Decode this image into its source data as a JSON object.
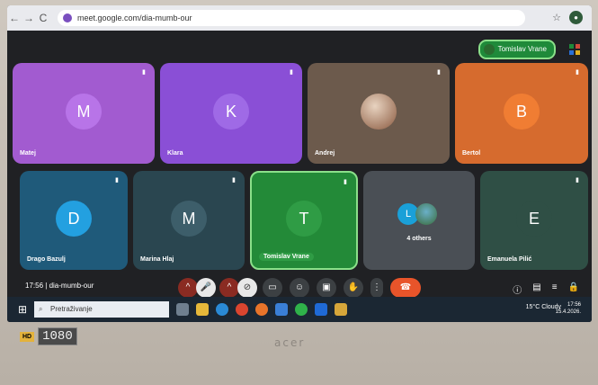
{
  "browser": {
    "url": "meet.google.com/dia-mumb-our"
  },
  "meeting": {
    "user_chip": "Tomislav Vrane",
    "meeting_time": "17:56",
    "meeting_code": "dia-mumb-our"
  },
  "tiles": [
    {
      "name": "Matej",
      "initial": "M",
      "bg": "#a25bd0",
      "circle": "#b874e8"
    },
    {
      "name": "Klara",
      "initial": "K",
      "bg": "#8a4fd6",
      "circle": "#9f6ae6"
    },
    {
      "name": "Andrej",
      "initial": "",
      "bg": "#6c5a4c",
      "circle": "#cfa18a"
    },
    {
      "name": "Bertol",
      "initial": "B",
      "bg": "#d66b2e",
      "circle": "#f07d33"
    },
    {
      "name": "Drago Bazulj",
      "initial": "D",
      "bg": "#1f5a7a",
      "circle": "#23a0e0"
    },
    {
      "name": "Marina Hlaj",
      "initial": "M",
      "bg": "#2a4650",
      "circle": "#3d5e6a"
    },
    {
      "name": "Tomislav Vrane",
      "initial": "T",
      "bg": "#238a38",
      "circle": "#2f9c45"
    },
    {
      "name": "4 others",
      "initial": "L",
      "bg": "#4a4f55",
      "circle": "#1aa0d8"
    },
    {
      "name": "Emanuela Pilić",
      "initial": "E",
      "bg": "#2f4f45",
      "circle": "#2f4f45"
    }
  ],
  "taskbar": {
    "search_placeholder": "Pretraživanje",
    "weather": "15°C Cloudy",
    "time": "17:56",
    "date": "15.4.2026."
  },
  "laptop": {
    "hd_label": "HD",
    "resolution_label": "1080",
    "brand": "acer"
  },
  "colors": {
    "accent_green": "#1f8a3a",
    "end_call": "#e8542a"
  }
}
